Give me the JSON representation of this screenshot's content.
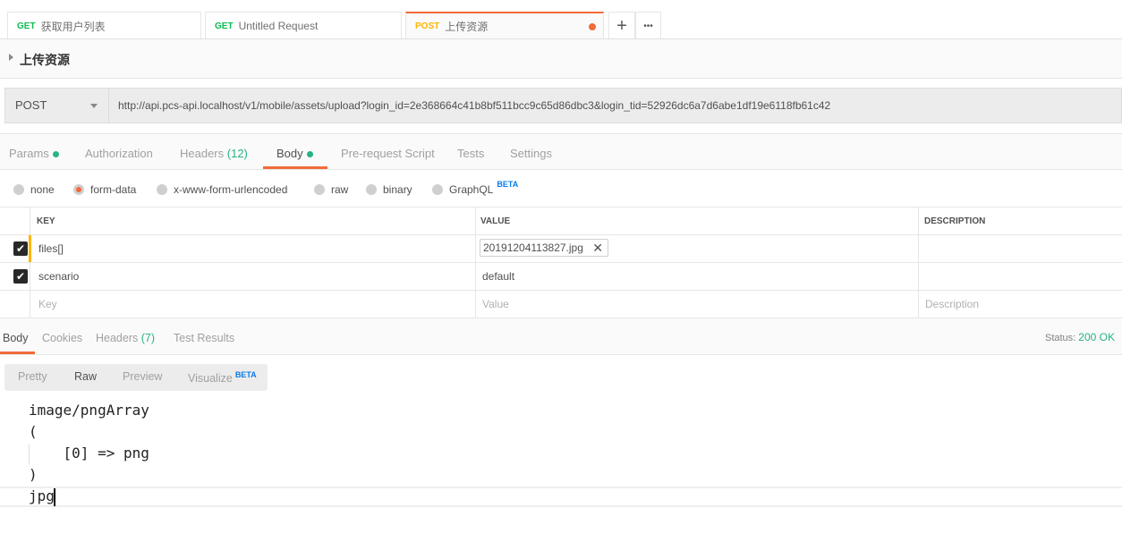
{
  "tabs": [
    {
      "method": "GET",
      "name": "获取用户列表"
    },
    {
      "method": "GET",
      "name": "Untitled Request"
    },
    {
      "method": "POST",
      "name": "上传资源",
      "unsaved": true
    }
  ],
  "tab_actions": {
    "add": "+",
    "more": "•••"
  },
  "request_name": "上传资源",
  "method": "POST",
  "url": "http://api.pcs-api.localhost/v1/mobile/assets/upload?login_id=2e368664c41b8bf511bcc9c65d86dbc3&login_tid=52926dc6a7d6abe1df19e6118fb61c42",
  "request_tabs": [
    {
      "label": "Params",
      "dot": true
    },
    {
      "label": "Authorization"
    },
    {
      "label": "Headers",
      "count": "(12)"
    },
    {
      "label": "Body",
      "dot": true,
      "active": true
    },
    {
      "label": "Pre-request Script"
    },
    {
      "label": "Tests"
    },
    {
      "label": "Settings"
    }
  ],
  "body_types": [
    "none",
    "form-data",
    "x-www-form-urlencoded",
    "raw",
    "binary",
    "GraphQL"
  ],
  "beta": "BETA",
  "table": {
    "headers": [
      "KEY",
      "VALUE",
      "DESCRIPTION"
    ],
    "rows": [
      {
        "key": "files[]",
        "value": "20191204113827.jpg",
        "checked": true
      },
      {
        "key": "scenario",
        "value": "default",
        "checked": true
      }
    ],
    "placeholders": {
      "key": "Key",
      "value": "Value",
      "description": "Description"
    }
  },
  "response_tabs": [
    {
      "label": "Body"
    },
    {
      "label": "Cookies"
    },
    {
      "label": "Headers",
      "count": "(7)"
    },
    {
      "label": "Test Results"
    }
  ],
  "status": {
    "label": "Status:",
    "value": "200 OK"
  },
  "view_modes": [
    "Pretty",
    "Raw",
    "Preview",
    "Visualize"
  ],
  "response_lines": [
    "image/pngArray",
    "(",
    "    [0] => png",
    ")",
    "jpg"
  ],
  "colors": {
    "accent": "#f26b3a",
    "green": "#26b47f",
    "beta": "#097bed"
  }
}
